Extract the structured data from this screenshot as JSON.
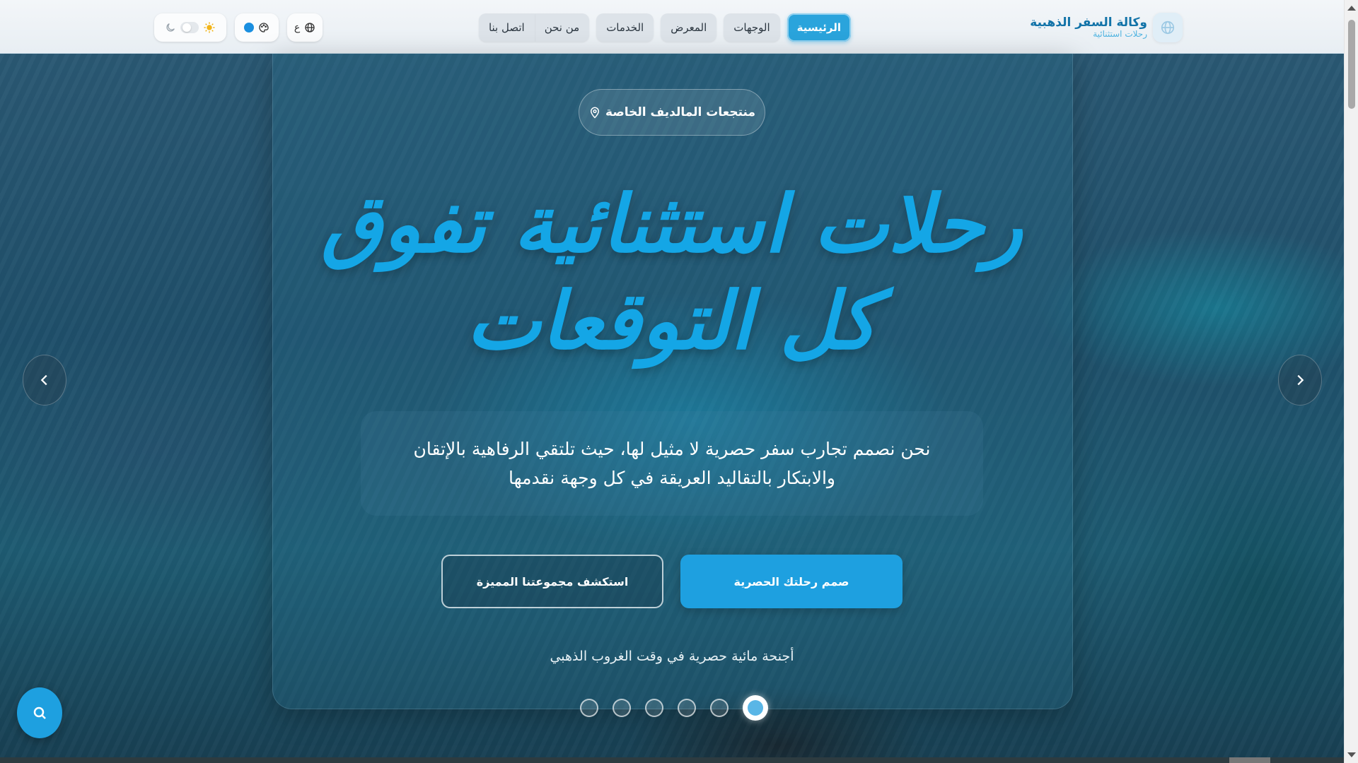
{
  "brand": {
    "title": "وكالة السفر الذهبية",
    "subtitle": "رحلات استثنائية",
    "icon": "globe-icon"
  },
  "nav": {
    "tabs": [
      {
        "label": "الرئيسية",
        "active": true
      },
      {
        "label": "الوجهات",
        "active": false
      },
      {
        "label": "المعرض",
        "active": false
      },
      {
        "label": "الخدمات",
        "active": false
      },
      {
        "label": "من نحن",
        "active": false
      },
      {
        "label": "اتصل بنا",
        "active": false
      }
    ]
  },
  "controls": {
    "language_label": "ع",
    "language_icon": "globe-icon",
    "palette_icon": "palette-icon",
    "theme_icons": [
      "moon-icon",
      "sun-icon"
    ]
  },
  "hero": {
    "location": "منتجعات المالديف الخاصة",
    "headline": "رحلات استثنائية تفوق كل التوقعات",
    "description": "نحن نصمم تجارب سفر حصرية لا مثيل لها، حيث تلتقي الرفاهية بالإتقان والابتكار بالتقاليد العريقة في كل وجهة نقدمها",
    "primary_button": "صمم رحلتك الحصرية",
    "secondary_button": "استكشف مجموعتنا المميزة",
    "caption": "أجنحة مائية حصرية في وقت الغروب الذهبي",
    "slides_count": 6,
    "active_slide_index": 5
  },
  "colors": {
    "accent": "#1ea0e0",
    "headline": "#14a6e6",
    "brand_title": "#1273a8"
  }
}
